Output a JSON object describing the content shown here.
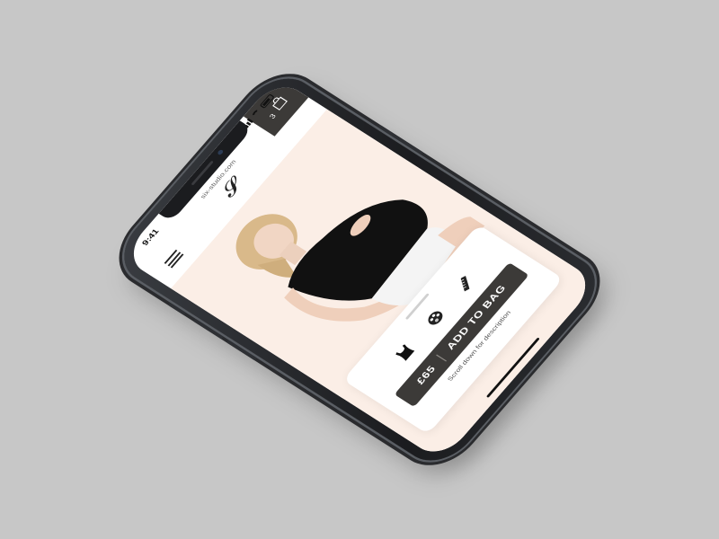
{
  "status_bar": {
    "time": "9:41"
  },
  "browser": {
    "url": "six-studio.com"
  },
  "brand": {
    "logo_text": "𝓢"
  },
  "cart": {
    "count": "3",
    "icon": "bag-icon"
  },
  "product": {
    "price": "£65",
    "add_to_bag_label": "ADD TO BAG",
    "scroll_hint": "Scroll down for description",
    "options": [
      {
        "icon": "top-silhouette-icon"
      },
      {
        "icon": "palette-icon"
      },
      {
        "icon": "ruler-icon"
      }
    ]
  },
  "colors": {
    "hero_bg": "#fbeee6",
    "accent_dark": "#3c3a38",
    "backdrop": "#c7c7c7"
  }
}
